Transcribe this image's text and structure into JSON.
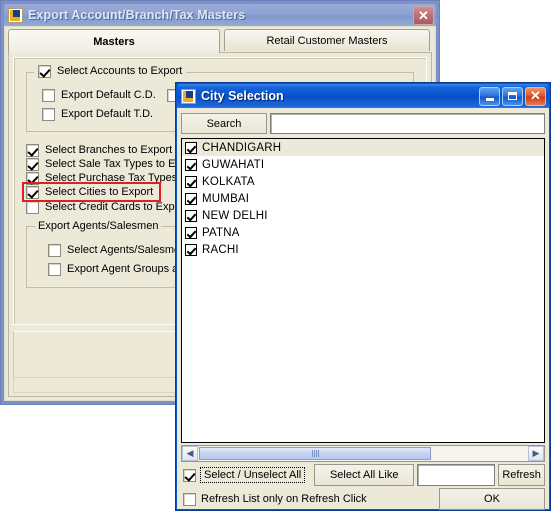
{
  "main_window": {
    "title": "Export Account/Branch/Tax Masters",
    "icon": "app-icon",
    "close_label": "✕",
    "tabs": [
      {
        "label": "Masters",
        "active": true
      },
      {
        "label": "Retail Customer Masters",
        "active": false
      }
    ],
    "accounts_group": {
      "legend_checkbox": {
        "label": "Select Accounts to Export",
        "checked": true
      },
      "items": [
        {
          "label": "Export Default C.D.",
          "checked": false
        },
        {
          "label": "Export Default T.D.",
          "checked": false
        }
      ],
      "right_checkbox": {
        "label": "",
        "checked": false
      }
    },
    "checkboxes": [
      {
        "label": "Select Branches to Export",
        "checked": true,
        "highlighted": false
      },
      {
        "label": "Select Sale Tax Types to Expo",
        "checked": true,
        "highlighted": false
      },
      {
        "label": "Select Purchase Tax Types to",
        "checked": true,
        "highlighted": false
      },
      {
        "label": "Select Cities to Export",
        "checked": true,
        "highlighted": true
      },
      {
        "label": "Select Credit Cards to Export",
        "checked": false,
        "highlighted": false
      }
    ],
    "agents_group": {
      "legend": "Export Agents/Salesmen",
      "items": [
        {
          "label": "Select Agents/Salesmen",
          "checked": false
        },
        {
          "label": "Export Agent Groups also",
          "checked": false
        }
      ]
    },
    "highlight_color": "#e02020"
  },
  "city_window": {
    "title": "City Selection",
    "icon": "app-icon",
    "minimize_label": "–",
    "maximize_label": "□",
    "close_label": "✕",
    "search": {
      "button_label": "Search",
      "button_accel": "r",
      "input_value": "",
      "input_placeholder": ""
    },
    "list": {
      "items": [
        {
          "label": "CHANDIGARH",
          "checked": true,
          "selected": true
        },
        {
          "label": "GUWAHATI",
          "checked": true,
          "selected": false
        },
        {
          "label": "KOLKATA",
          "checked": true,
          "selected": false
        },
        {
          "label": "MUMBAI",
          "checked": true,
          "selected": false
        },
        {
          "label": "NEW DELHI",
          "checked": true,
          "selected": false
        },
        {
          "label": "PATNA",
          "checked": true,
          "selected": false
        },
        {
          "label": "RACHI",
          "checked": true,
          "selected": false
        }
      ]
    },
    "hscroll": {
      "left_arrow": "◀",
      "right_arrow": "▶"
    },
    "footer": {
      "select_unselect_all": {
        "label": "Select / Unselect All",
        "checked": true
      },
      "select_all_like_button": "Select All Like",
      "select_all_like_value": "",
      "refresh_button": "Refresh",
      "refresh_on_click": {
        "label": "Refresh List only on Refresh Click",
        "checked": false
      },
      "ok_button": "OK"
    }
  }
}
